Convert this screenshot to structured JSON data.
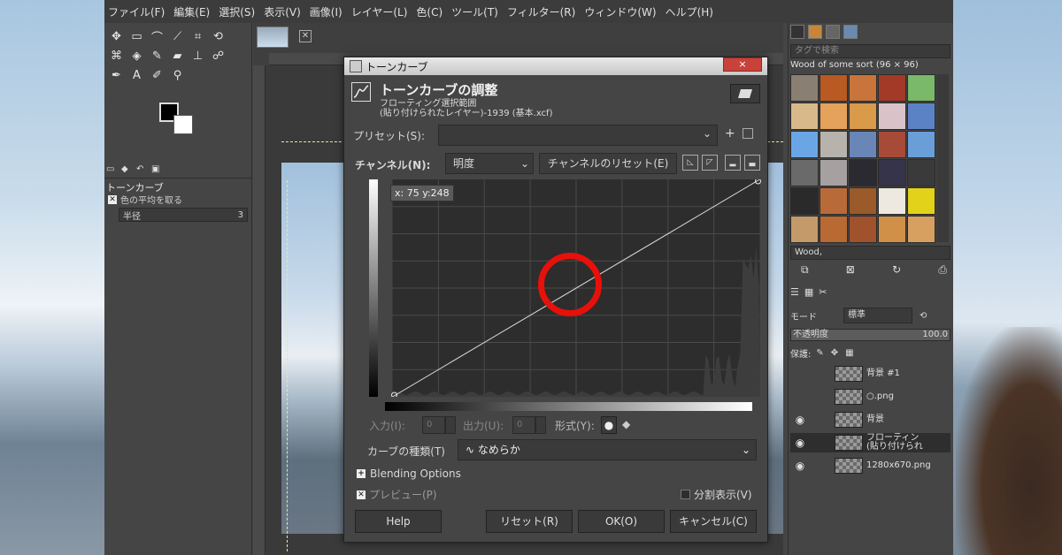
{
  "menu": [
    "ファイル(F)",
    "編集(E)",
    "選択(S)",
    "表示(V)",
    "画像(I)",
    "レイヤー(L)",
    "色(C)",
    "ツール(T)",
    "フィルター(R)",
    "ウィンドウ(W)",
    "ヘルプ(H)"
  ],
  "toolbox": {
    "tool_options_title": "トーンカーブ",
    "sample_average_label": "色の平均を取る",
    "radius_label": "半径",
    "radius_value": "3"
  },
  "patterns": {
    "tag_placeholder": "タグで検索",
    "current_pattern": "Wood of some sort (96 × 96)",
    "selected": "Wood,",
    "swatches": [
      "#8a7f73",
      "#b85a22",
      "#c8743a",
      "#a33a28",
      "#7ab86a",
      "#d7b98a",
      "#e5a25a",
      "#d99a4a",
      "#d9c3c8",
      "#5b82c4",
      "#6aa6e6",
      "#b7b3ac",
      "#6a86b6",
      "#a84a38",
      "#6a9ed8",
      "#6a6a6a",
      "#a7a0a0",
      "#2a2a30",
      "#36344a",
      "#3a3a3a",
      "#2a2a2a",
      "#b86a38",
      "#9a5a2a",
      "#ede9e1",
      "#e3d21a",
      "#c49a6a",
      "#b86a32",
      "#a0522d",
      "#d09048",
      "#d8a060"
    ]
  },
  "layers": {
    "mode_label": "モード",
    "mode_value": "標準",
    "opacity_label": "不透明度",
    "opacity_value": "100.0",
    "protect_label": "保護:",
    "rows": [
      {
        "name": "背景 #1",
        "visible": false,
        "active": false
      },
      {
        "name": "○.png",
        "visible": false,
        "active": false
      },
      {
        "name": "背景",
        "visible": true,
        "active": false
      },
      {
        "name": "フローティン",
        "name2": "(貼り付けられ",
        "visible": true,
        "active": true
      },
      {
        "name": "1280x670.png",
        "visible": true,
        "active": false
      }
    ]
  },
  "dialog": {
    "window_title": "トーンカーブ",
    "close_symbol": "×",
    "heading": "トーンカーブの調整",
    "subheading": "フローティング選択範囲",
    "subheading2": "(貼り付けられたレイヤー)-1939 (基本.xcf)",
    "preset_label": "プリセット(S):",
    "channel_label": "チャンネル(N):",
    "channel_value": "明度",
    "channel_reset": "チャンネルのリセット(E)",
    "readout": "x: 75 y:248",
    "input_label": "入力(I):",
    "input_value": "0",
    "output_label": "出力(U):",
    "output_value": "0",
    "format_label": "形式(Y):",
    "curve_type_label": "カーブの種類(T)",
    "curve_type_value": "なめらか",
    "blending_label": "Blending Options",
    "preview_label": "プレビュー(P)",
    "split_label": "分割表示(V)",
    "btn_help": "Help",
    "btn_reset": "リセット(R)",
    "btn_ok": "OK(O)",
    "btn_cancel": "キャンセル(C)"
  },
  "curve_data": {
    "points": [
      [
        0,
        0
      ],
      [
        255,
        255
      ]
    ]
  }
}
